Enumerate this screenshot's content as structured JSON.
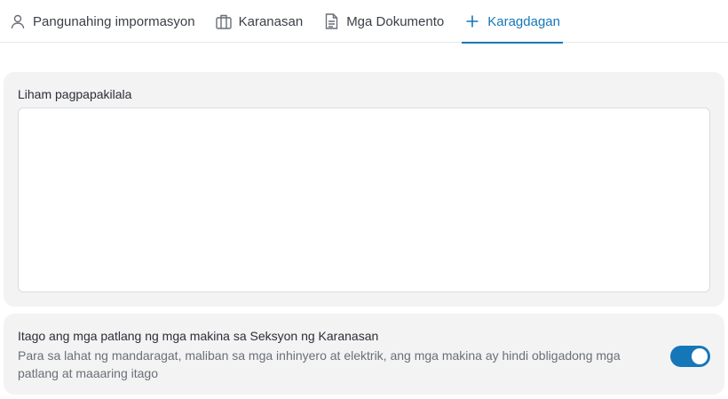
{
  "tabs": [
    {
      "label": "Pangunahing impormasyon",
      "icon": "person-icon",
      "active": false
    },
    {
      "label": "Karanasan",
      "icon": "briefcase-icon",
      "active": false
    },
    {
      "label": "Mga Dokumento",
      "icon": "document-icon",
      "active": false
    },
    {
      "label": "Karagdagan",
      "icon": "plus-icon",
      "active": true
    }
  ],
  "cover_letter": {
    "label": "Liham pagpapakilala",
    "value": ""
  },
  "hide_machines": {
    "title": "Itago ang mga patlang ng mga makina sa Seksyon ng Karanasan",
    "description": "Para sa lahat ng mandaragat, maliban sa mga inhinyero at elektrik, ang mga makina ay hindi obligadong mga patlang at maaaring itago",
    "enabled": true
  },
  "colors": {
    "accent": "#1677b8",
    "card_background": "#f3f3f4",
    "muted_text": "#6a6f77"
  }
}
